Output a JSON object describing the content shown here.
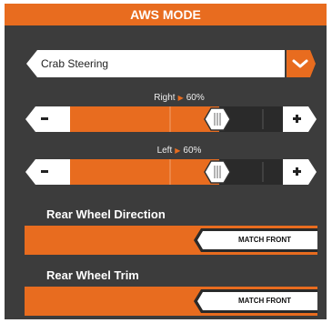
{
  "title": "AWS MODE",
  "mode_select": {
    "value": "Crab Steering"
  },
  "right_slider": {
    "label": "Right",
    "value_text": "60%",
    "value": 0.6
  },
  "left_slider": {
    "label": "Left",
    "value_text": "60%",
    "value": 0.6
  },
  "rear_direction": {
    "label": "Rear Wheel Direction",
    "option": "MATCH FRONT"
  },
  "rear_trim": {
    "label": "Rear Wheel Trim",
    "option": "MATCH FRONT"
  },
  "colors": {
    "accent": "#e86c1f",
    "panel": "#3c3c3c",
    "track_dark": "#2a2a2a"
  },
  "icons": {
    "dropdown": "chevron-down-icon",
    "decrease": "minus-icon",
    "increase": "plus-icon",
    "handle": "hexagon-handle-icon"
  }
}
